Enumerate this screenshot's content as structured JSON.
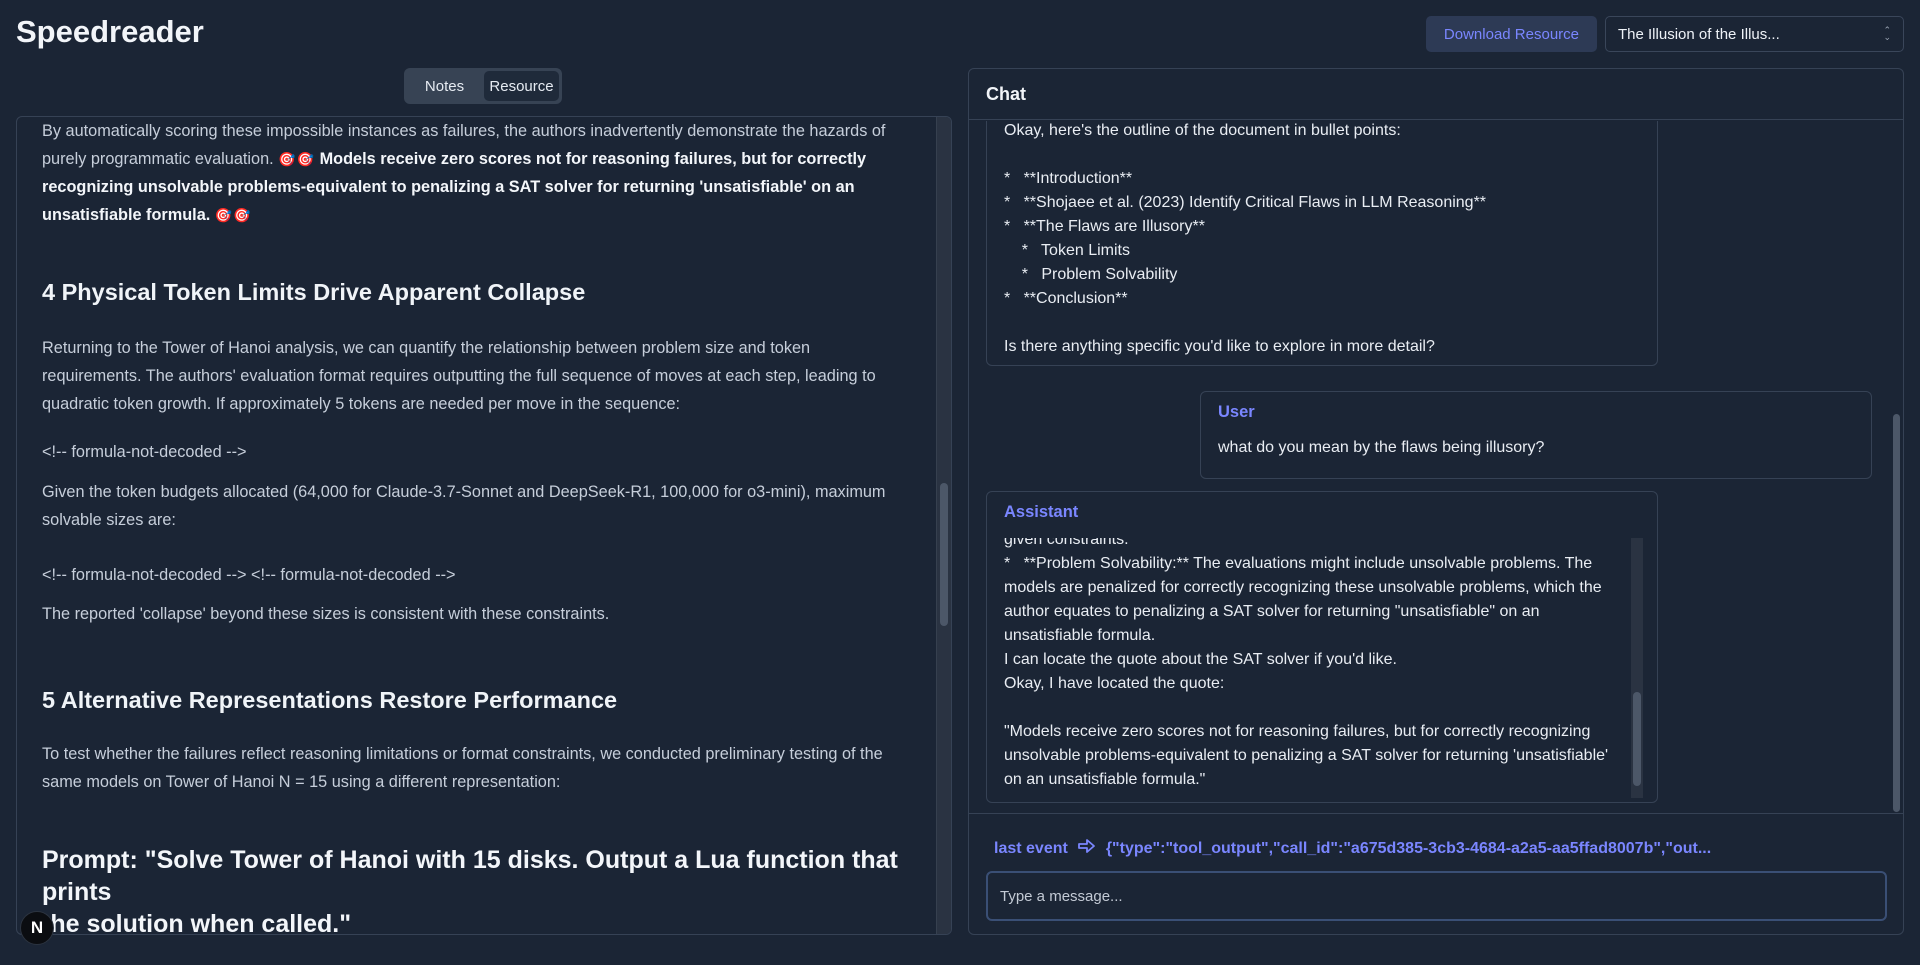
{
  "app": {
    "title": "Speedreader"
  },
  "header": {
    "download_label": "Download Resource",
    "doc_select_value": "The Illusion of the Illus..."
  },
  "tabs": [
    {
      "label": "Notes",
      "active": false
    },
    {
      "label": "Resource",
      "active": true
    }
  ],
  "document": {
    "p1_a": "By automatically scoring these impossible instances as failures, the authors inadvertently demonstrate the hazards of",
    "p1_b": "purely programmatic evaluation.",
    "p1_emoji": "🎯🎯",
    "p1_bold_a": "Models receive zero scores not for reasoning failures, but for correctly",
    "p1_bold_b": "recognizing unsolvable problems-equivalent to penalizing a SAT solver for returning 'unsatisfiable' on an",
    "p1_bold_c": "unsatisfiable formula.",
    "h4": "4 Physical Token Limits Drive Apparent Collapse",
    "p2_a": "Returning to the Tower of Hanoi analysis, we can quantify the relationship between problem size and token",
    "p2_b": "requirements. The authors' evaluation format requires outputting the full sequence of moves at each step, leading to",
    "p2_c": "quadratic token growth. If approximately 5 tokens are needed per move in the sequence:",
    "f1": "<!-- formula-not-decoded -->",
    "p3_a": "Given the token budgets allocated (64,000 for Claude-3.7-Sonnet and DeepSeek-R1, 100,000 for o3-mini), maximum",
    "p3_b": "solvable sizes are:",
    "f2": "<!-- formula-not-decoded --> <!-- formula-not-decoded -->",
    "p4": "The reported 'collapse' beyond these sizes is consistent with these constraints.",
    "h5": "5 Alternative Representations Restore Performance",
    "p5_a": "To test whether the failures reflect reasoning limitations or format constraints, we conducted preliminary testing of the",
    "p5_b": "same models on Tower of Hanoi N = 15 using a different representation:",
    "prompt_a": "Prompt: \"Solve Tower of Hanoi with 15 disks. Output a Lua function that prints",
    "prompt_b": "the solution when called.\""
  },
  "badge": {
    "letter": "N"
  },
  "chat": {
    "title": "Chat",
    "msg1_lines": [
      "Okay, here's the outline of the document in bullet points:",
      "",
      "*   **Introduction**",
      "*   **Shojaee et al. (2023) Identify Critical Flaws in LLM Reasoning**",
      "*   **The Flaws are Illusory**",
      "    *   Token Limits",
      "    *   Problem Solvability",
      "*   **Conclusion**",
      "",
      "Is there anything specific you'd like to explore in more detail?"
    ],
    "user_role": "User",
    "user_text": "what do you mean by the flaws being illusory?",
    "assistant_role": "Assistant",
    "msg3_lines": [
      "given constraints.",
      "*   **Problem Solvability:** The evaluations might include unsolvable problems. The",
      "models are penalized for correctly recognizing these unsolvable problems, which the",
      "author equates to penalizing a SAT solver for returning \"unsatisfiable\" on an",
      "unsatisfiable formula.",
      "I can locate the quote about the SAT solver if you'd like.",
      "Okay, I have located the quote:",
      "",
      "\"Models receive zero scores not for reasoning failures, but for correctly recognizing",
      "unsolvable problems-equivalent to penalizing a SAT solver for returning 'unsatisfiable'",
      "on an unsatisfiable formula.\""
    ],
    "last_event_label": "last event",
    "last_event_value": "{\"type\":\"tool_output\",\"call_id\":\"a675d385-3cb3-4684-a2a5-aa5ffad8007b\",\"out...",
    "input_placeholder": "Type a message..."
  },
  "colors": {
    "accent": "#7a86ff",
    "background": "#1b2535",
    "border": "#364255"
  }
}
